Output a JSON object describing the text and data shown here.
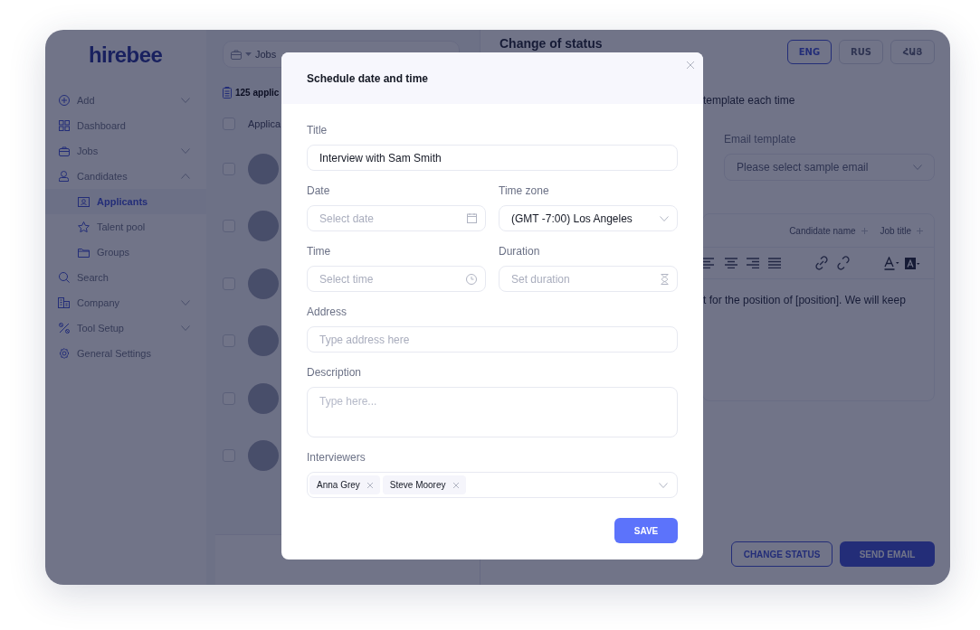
{
  "logo": "hirebee",
  "sidebar": {
    "items": [
      {
        "label": "Add",
        "expanded": false
      },
      {
        "label": "Dashboard"
      },
      {
        "label": "Jobs",
        "expanded": false
      },
      {
        "label": "Candidates",
        "expanded": true,
        "children": [
          {
            "label": "Applicants",
            "selected": true
          },
          {
            "label": "Talent pool",
            "selected": false
          },
          {
            "label": "Groups",
            "selected": false
          }
        ]
      },
      {
        "label": "Search"
      },
      {
        "label": "Company",
        "expanded": false
      },
      {
        "label": "Tool Setup",
        "expanded": false
      },
      {
        "label": "General Settings"
      }
    ]
  },
  "list_panel": {
    "breadcrumb": "Jobs",
    "count": "125 applic",
    "column_header": "Applica",
    "select_all_checked": false,
    "rows": [
      {
        "checked": false
      },
      {
        "checked": false
      },
      {
        "checked": false
      },
      {
        "checked": false
      },
      {
        "checked": false
      },
      {
        "checked": false
      }
    ]
  },
  "right_panel": {
    "title": "Change of status",
    "languages": [
      {
        "label": "ENG",
        "selected": true
      },
      {
        "label": "RUS",
        "selected": false
      },
      {
        "label": "ՀԱՅ",
        "selected": false
      }
    ],
    "option_text": "template each time",
    "email_template": {
      "label": "Email template",
      "placeholder": "Please select sample email"
    },
    "variables": [
      "Candidate name",
      "Job title"
    ],
    "body_text": "t for the position of [position]. We will keep",
    "buttons": [
      {
        "label": "CHANGE STATUS",
        "kind": "outline"
      },
      {
        "label": "SEND EMAIL",
        "kind": "primary"
      }
    ]
  },
  "modal": {
    "title": "Schedule date and time",
    "rows": [
      [
        {
          "label": "Title",
          "kind": "text",
          "value": "Interview with Sam Smith"
        }
      ],
      [
        {
          "label": "Date",
          "kind": "date",
          "placeholder": "Select date"
        },
        {
          "label": "Time zone",
          "kind": "select",
          "value": "(GMT -7:00) Los Angeles"
        }
      ],
      [
        {
          "label": "Time",
          "kind": "time",
          "placeholder": "Select time"
        },
        {
          "label": "Duration",
          "kind": "duration",
          "placeholder": "Set duration"
        }
      ],
      [
        {
          "label": "Address",
          "kind": "text",
          "placeholder": "Type address here"
        }
      ],
      [
        {
          "label": "Description",
          "kind": "textarea",
          "placeholder": "Type here..."
        }
      ]
    ],
    "interviewers": {
      "label": "Interviewers",
      "chips": [
        "Anna Grey",
        "Steve Moorey"
      ]
    },
    "save": "SAVE"
  }
}
